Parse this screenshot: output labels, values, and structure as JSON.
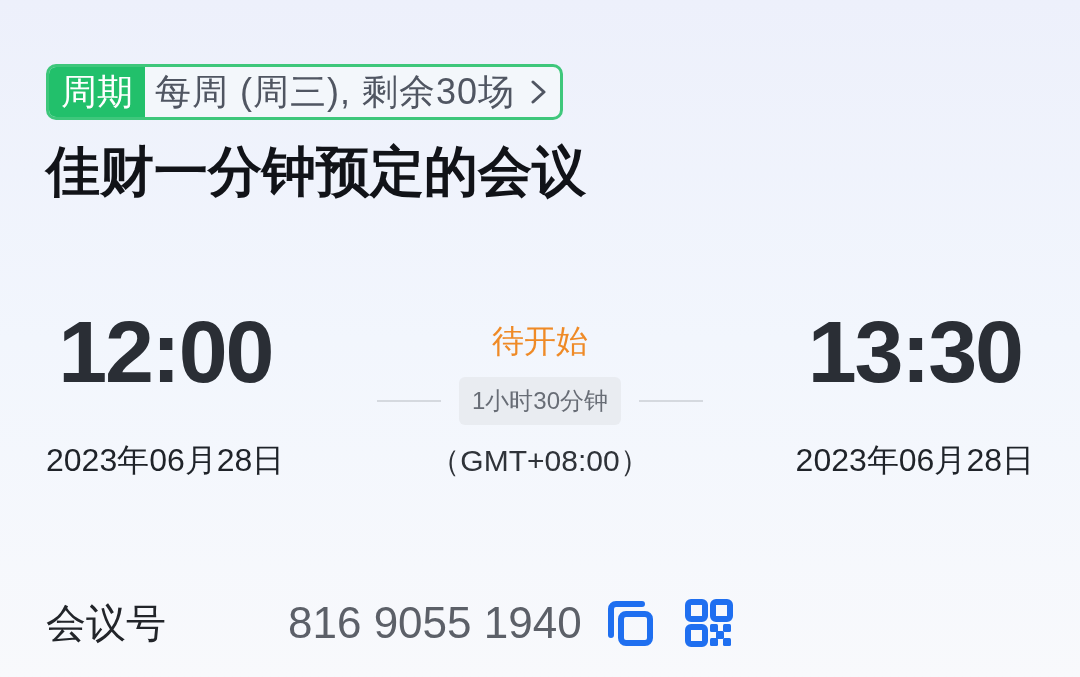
{
  "recurrence": {
    "label": "周期",
    "summary": "每周 (周三), 剩余30场"
  },
  "title": "佳财一分钟预定的会议",
  "schedule": {
    "start": {
      "time": "12:00",
      "date": "2023年06月28日"
    },
    "status": "待开始",
    "duration": "1小时30分钟",
    "timezone": "（GMT+08:00）",
    "end": {
      "time": "13:30",
      "date": "2023年06月28日"
    }
  },
  "meeting_id": {
    "label": "会议号",
    "value": "816 9055 1940"
  }
}
